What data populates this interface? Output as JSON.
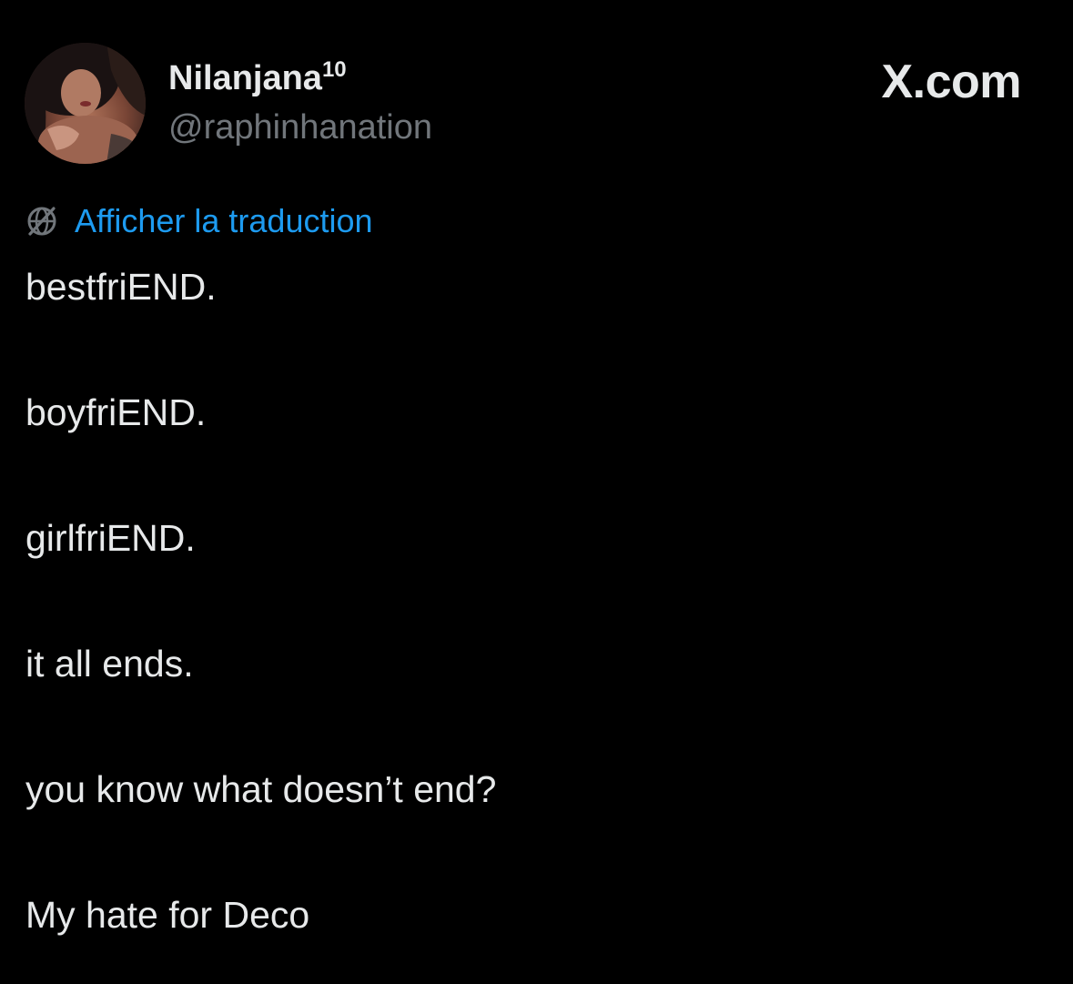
{
  "author": {
    "display_name": "Nilanjana",
    "display_name_superscript": "10",
    "handle": "@raphinhanation"
  },
  "brand": {
    "label": "X.com"
  },
  "translate": {
    "icon": "no-translate-globe-icon",
    "label": "Afficher la traduction",
    "color": "#1d9bf0"
  },
  "tweet": {
    "lines": [
      "bestfriEND.",
      "boyfriEND.",
      "girlfriEND.",
      "it all ends.",
      "you know what doesn’t end?",
      "My hate for Deco"
    ]
  },
  "colors": {
    "background": "#000000",
    "primary_text": "#e7e9ea",
    "secondary_text": "#71767b",
    "link": "#1d9bf0"
  }
}
